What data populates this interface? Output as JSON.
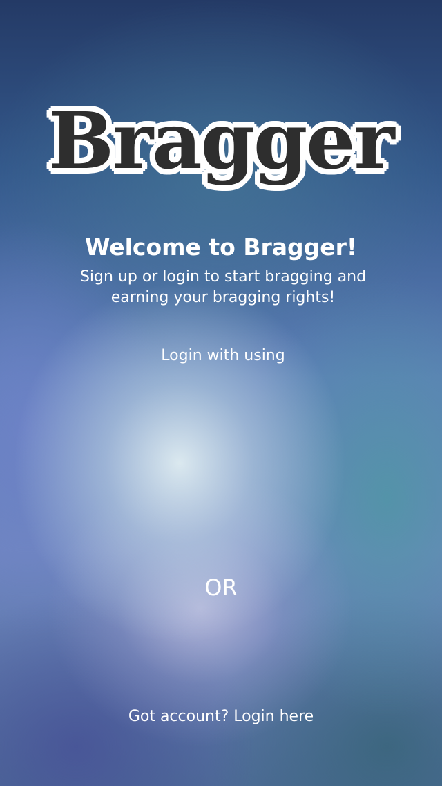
{
  "app": {
    "logo_text": "Bragger"
  },
  "welcome": {
    "title": "Welcome to Bragger!",
    "subtitle": "Sign up or login to start bragging and earning your bragging rights!"
  },
  "social_login": {
    "label": "Login with using"
  },
  "divider": {
    "label": "OR"
  },
  "footer": {
    "login_link": "Got account? Login here"
  },
  "colors": {
    "logo_fill": "#2e2e2e",
    "logo_outline": "#ffffff",
    "text": "#ffffff",
    "background_top": "#243a66",
    "background_center": "#e1eef2"
  }
}
